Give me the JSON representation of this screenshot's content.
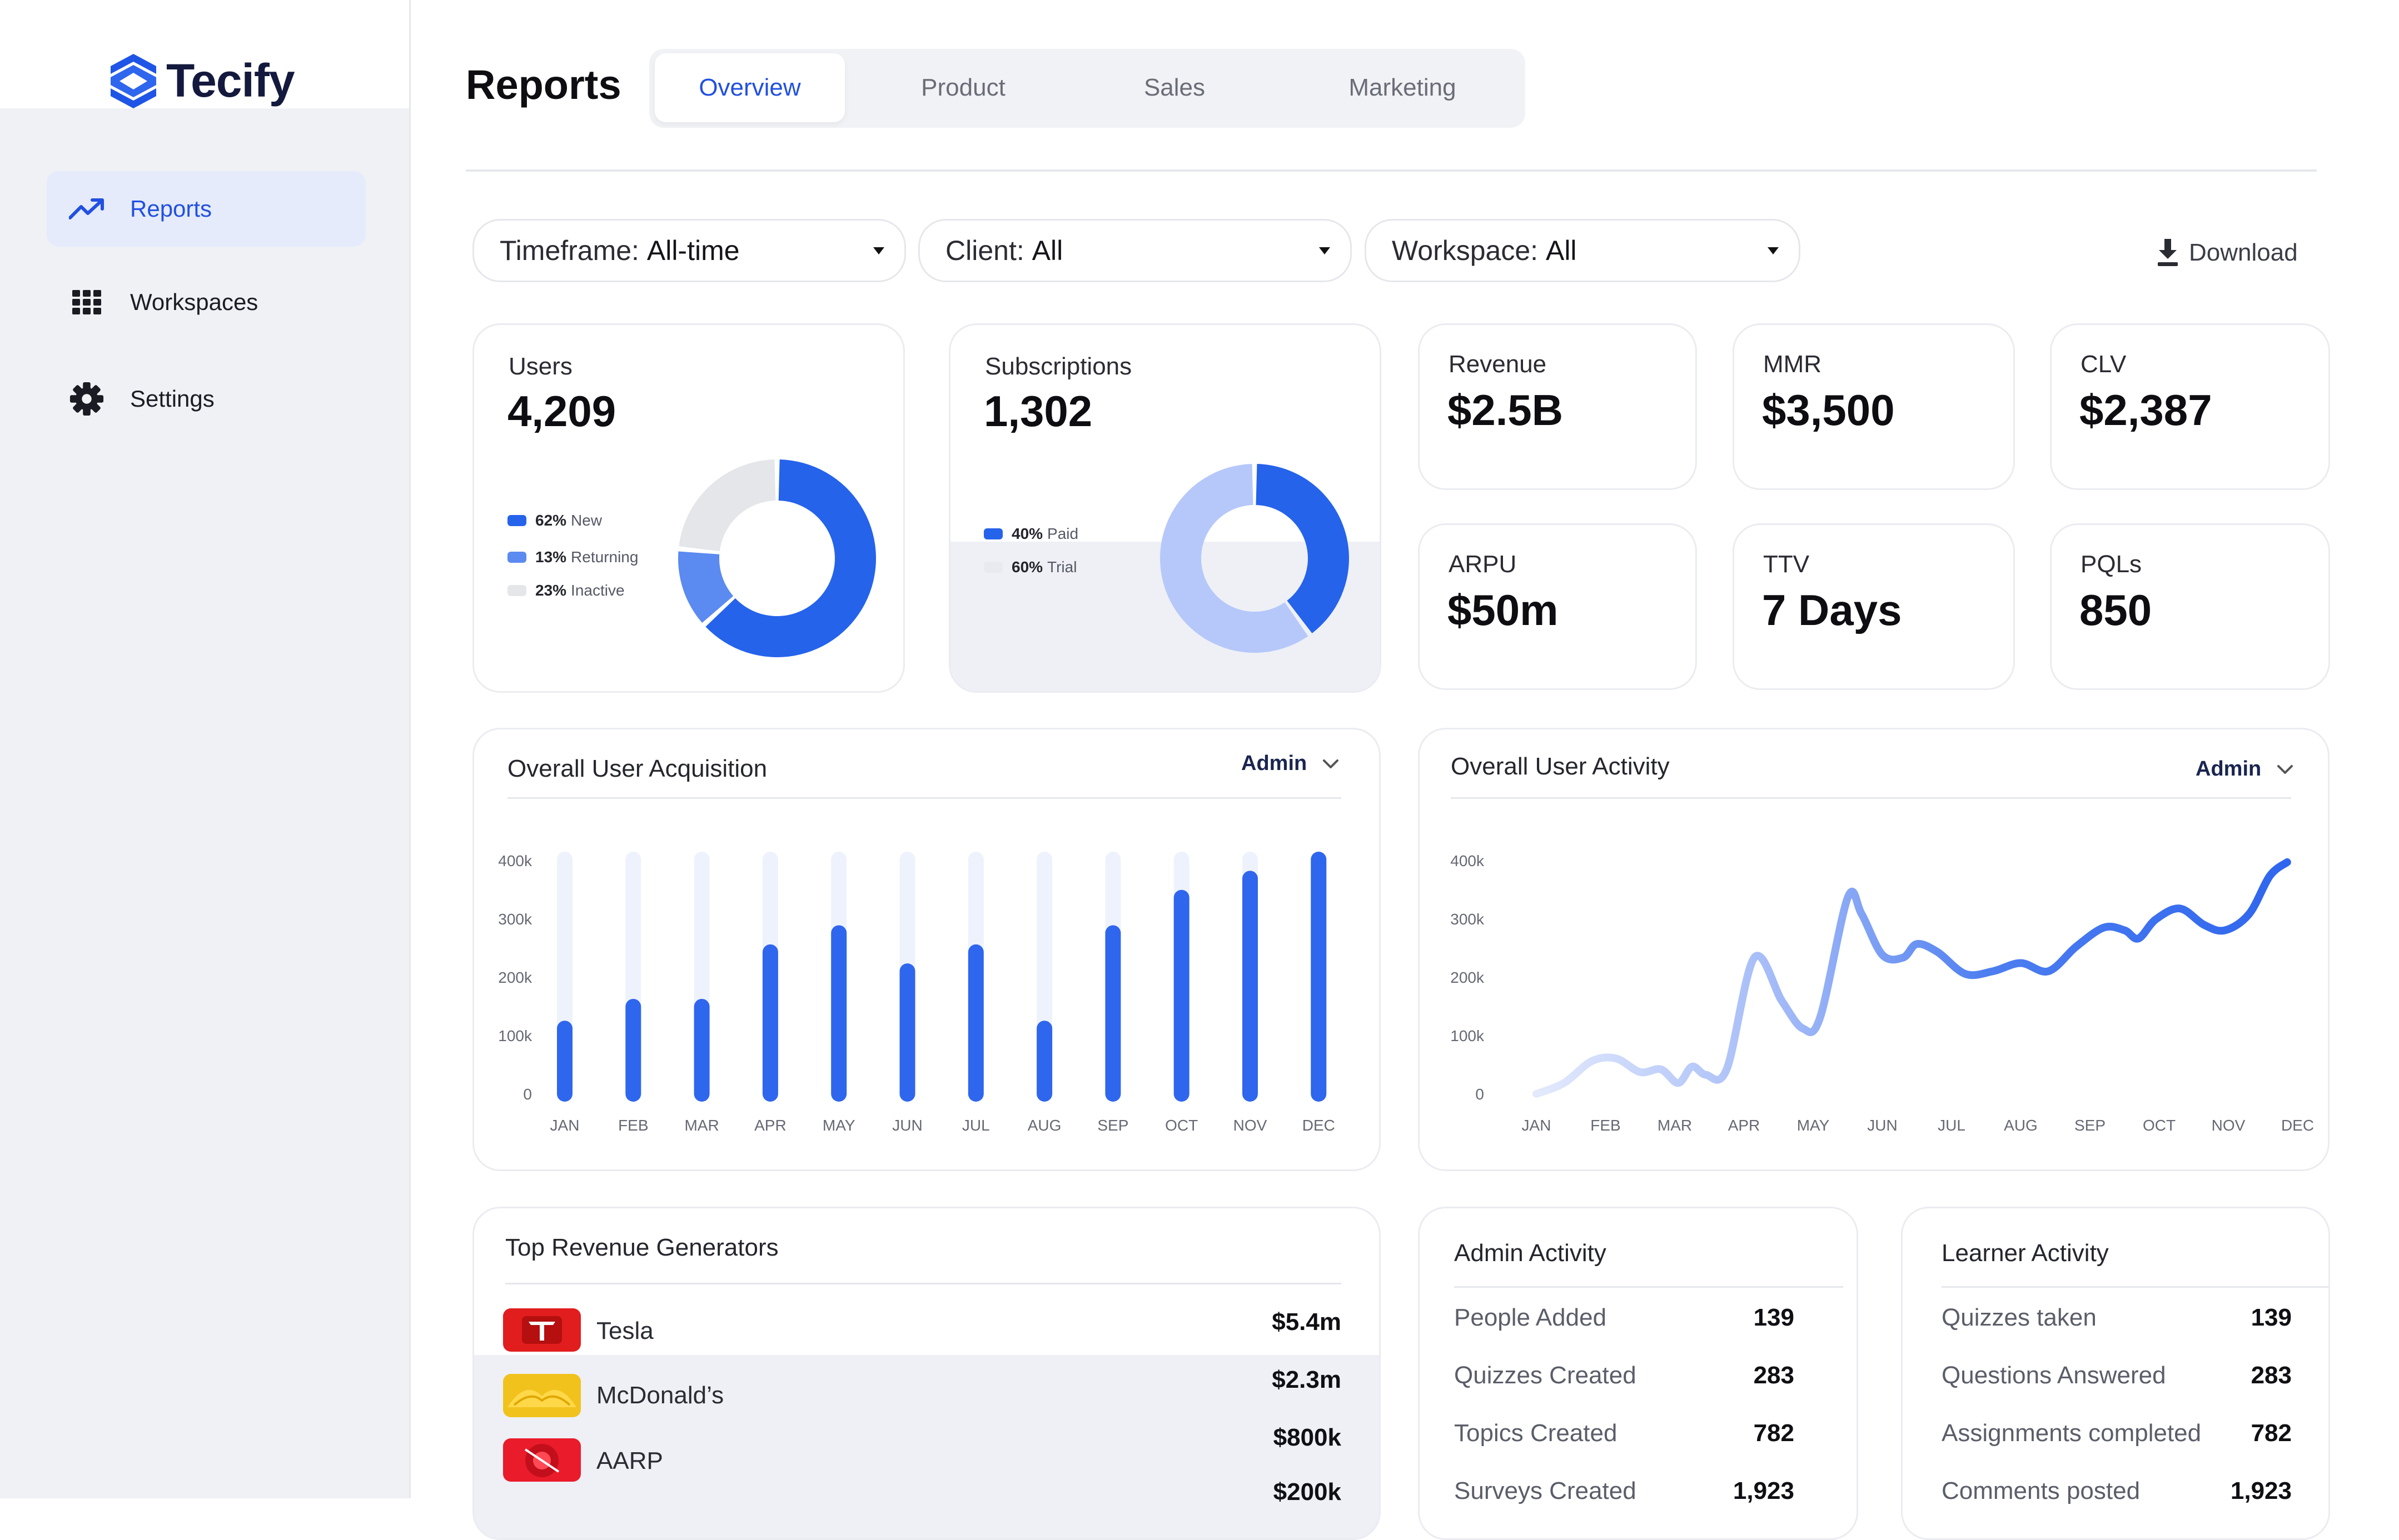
{
  "brand": {
    "name": "Tecify",
    "logo_icon": "tecify-logo-icon"
  },
  "sidebar": {
    "items": [
      {
        "label": "Reports",
        "icon": "trend-up-icon",
        "active": true
      },
      {
        "label": "Workspaces",
        "icon": "grid-icon",
        "active": false
      },
      {
        "label": "Settings",
        "icon": "gear-icon",
        "active": false
      }
    ]
  },
  "header": {
    "title": "Reports",
    "tabs": [
      {
        "label": "Overview",
        "active": true
      },
      {
        "label": "Product",
        "active": false
      },
      {
        "label": "Sales",
        "active": false
      },
      {
        "label": "Marketing",
        "active": false
      }
    ]
  },
  "filters": [
    {
      "prefix": "Timeframe: ",
      "value": "All-time"
    },
    {
      "prefix": "Client: ",
      "value": "All"
    },
    {
      "prefix": "Workspace: ",
      "value": "All"
    }
  ],
  "download_label": "Download",
  "stats": {
    "users": {
      "label": "Users",
      "value": "4,209",
      "legend": [
        {
          "pct": "62%",
          "name": "New",
          "color": "#2563eb"
        },
        {
          "pct": "13%",
          "name": "Returning",
          "color": "#5b8af0"
        },
        {
          "pct": "23%",
          "name": "Inactive",
          "color": "#e4e6ea"
        }
      ]
    },
    "subscriptions": {
      "label": "Subscriptions",
      "value": "1,302",
      "legend": [
        {
          "pct": "40%",
          "name": "Paid",
          "color": "#2563eb"
        },
        {
          "pct": "60%",
          "name": "Trial",
          "color": "#e8eaf0"
        }
      ]
    },
    "revenue": {
      "label": "Revenue",
      "value": "$2.5B"
    },
    "mmr": {
      "label": "MMR",
      "value": "$3,500"
    },
    "clv": {
      "label": "CLV",
      "value": "$2,387"
    },
    "arpu": {
      "label": "ARPU",
      "value": "$50m"
    },
    "ttv": {
      "label": "TTV",
      "value": "7 Days"
    },
    "pqls": {
      "label": "PQLs",
      "value": "850"
    }
  },
  "acquisition": {
    "title": "Overall User Acquisition",
    "filter": "Admin"
  },
  "activity": {
    "title": "Overall User Activity",
    "filter": "Admin"
  },
  "chart_data": [
    {
      "type": "pie",
      "categories": [
        "New",
        "Returning",
        "Inactive"
      ],
      "values": [
        62,
        13,
        23
      ],
      "colors": [
        "#2563eb",
        "#5b8af0",
        "#e4e6ea"
      ]
    },
    {
      "type": "pie",
      "categories": [
        "Paid",
        "Trial"
      ],
      "values": [
        40,
        60
      ],
      "colors": [
        "#2563eb",
        "#b6c8fa"
      ]
    },
    {
      "type": "bar",
      "title": "Overall User Acquisition",
      "categories": [
        "JAN",
        "FEB",
        "MAR",
        "APR",
        "MAY",
        "JUN",
        "JUL",
        "AUG",
        "SEP",
        "OCT",
        "NOV",
        "DEC"
      ],
      "values": [
        120000,
        160000,
        160000,
        260000,
        295000,
        225000,
        260000,
        120000,
        295000,
        360000,
        395000,
        430000
      ],
      "ylim": [
        0,
        430000
      ],
      "yticks": [
        "0",
        "100k",
        "200k",
        "300k",
        "400k"
      ],
      "grid": false,
      "color": "#2f66ee"
    },
    {
      "type": "line",
      "title": "Overall User Activity",
      "categories": [
        "JAN",
        "FEB",
        "MAR",
        "APR",
        "MAY",
        "JUN",
        "JUL",
        "AUG",
        "SEP",
        "OCT",
        "NOV",
        "DEC"
      ],
      "x": [
        0,
        0.4,
        0.8,
        1.15,
        1.5,
        1.8,
        2.05,
        2.25,
        2.45,
        2.75,
        3.15,
        3.55,
        3.85,
        4.1,
        4.5,
        4.7,
        5.0,
        5.3,
        5.5,
        5.8,
        6.2,
        6.6,
        7.0,
        7.4,
        7.8,
        8.2,
        8.5,
        8.7,
        8.95,
        9.3,
        9.65,
        9.95,
        10.3,
        10.6,
        10.85
      ],
      "values": [
        0,
        20000,
        60000,
        65000,
        40000,
        45000,
        20000,
        50000,
        35000,
        45000,
        250000,
        170000,
        120000,
        140000,
        360000,
        330000,
        255000,
        250000,
        275000,
        260000,
        220000,
        225000,
        240000,
        225000,
        270000,
        305000,
        300000,
        285000,
        320000,
        340000,
        310000,
        300000,
        330000,
        400000,
        425000
      ],
      "ylim": [
        0,
        430000
      ],
      "yticks": [
        "0",
        "100k",
        "200k",
        "300k",
        "400k"
      ],
      "grid": false,
      "color": "#2f66ee"
    }
  ],
  "revenue_generators": {
    "title": "Top Revenue Generators",
    "rows": [
      {
        "name": "Tesla",
        "value": "$5.4m",
        "logo": "tesla-logo",
        "color": "#e11d1d"
      },
      {
        "name": "McDonald’s",
        "value": "$2.3m",
        "logo": "mcdonalds-logo",
        "color": "#f2c21c"
      },
      {
        "name": "AARP",
        "value": "$800k",
        "logo": "aarp-logo",
        "color": "#ea1b2a"
      },
      {
        "name": "",
        "value": "$200k",
        "logo": "",
        "color": ""
      }
    ]
  },
  "admin_activity": {
    "title": "Admin Activity",
    "rows": [
      {
        "name": "People Added",
        "value": "139"
      },
      {
        "name": "Quizzes Created",
        "value": "283"
      },
      {
        "name": "Topics Created",
        "value": "782"
      },
      {
        "name": "Surveys Created",
        "value": "1,923"
      }
    ]
  },
  "learner_activity": {
    "title": "Learner Activity",
    "rows": [
      {
        "name": "Quizzes taken",
        "value": "139"
      },
      {
        "name": "Questions Answered",
        "value": "283"
      },
      {
        "name": "Assignments completed",
        "value": "782"
      },
      {
        "name": "Comments posted",
        "value": "1,923"
      }
    ]
  }
}
